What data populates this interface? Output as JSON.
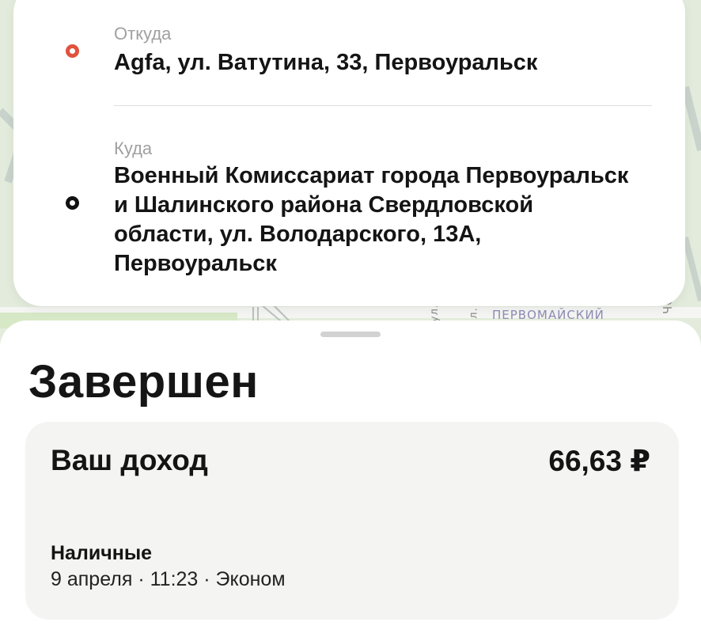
{
  "map": {
    "district_label": "ПЕРВОМАЙСКИЙ",
    "street_label_1": "ул.",
    "street_label_2": "л.",
    "street_label_3": "Чор"
  },
  "route": {
    "from": {
      "label": "Откуда",
      "value": "Agfa, ул. Ватутина, 33, Первоуральск",
      "icon": "origin-circle-icon",
      "color": "#e0523d"
    },
    "to": {
      "label": "Куда",
      "value": "Военный Комиссариат города Первоуральск и Шалинского района Свердловской области, ул. Володарского, 13А, Первоуральск",
      "icon": "destination-circle-icon",
      "color": "#111111"
    }
  },
  "order": {
    "status": "Завершен",
    "income_label": "Ваш доход",
    "income_amount": "66,63 ₽",
    "payment_method": "Наличные",
    "meta": "9 апреля · 11:23 · Эконом"
  }
}
